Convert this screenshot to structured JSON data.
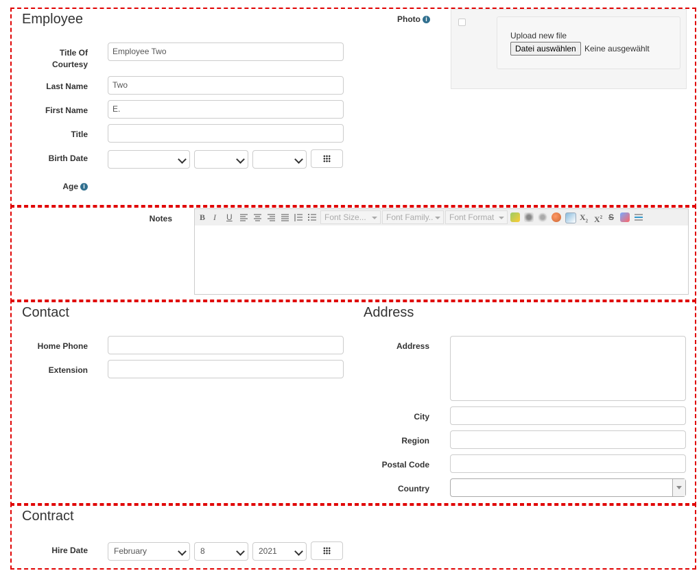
{
  "employee": {
    "heading": "Employee",
    "title_of_courtesy_label": "Title Of Courtesy",
    "title_of_courtesy_value": "Employee Two",
    "last_name_label": "Last Name",
    "last_name_value": "Two",
    "first_name_label": "First Name",
    "first_name_value": "E.",
    "title_label": "Title",
    "title_value": "",
    "birth_date_label": "Birth Date",
    "birth_month": "",
    "birth_day": "",
    "birth_year": "",
    "age_label": "Age",
    "photo_label": "Photo",
    "upload_label": "Upload new file",
    "file_button": "Datei auswählen",
    "file_status": "Keine ausgewählt"
  },
  "notes": {
    "label": "Notes",
    "toolbar": {
      "bold": "B",
      "italic": "I",
      "underline": "U",
      "font_size": "Font Size...",
      "font_family": "Font Family..",
      "font_format": "Font Format",
      "subscript": "X",
      "superscript": "X",
      "strike": "S"
    }
  },
  "contact": {
    "heading": "Contact",
    "home_phone_label": "Home Phone",
    "home_phone_value": "",
    "extension_label": "Extension",
    "extension_value": ""
  },
  "address": {
    "heading": "Address",
    "address_label": "Address",
    "city_label": "City",
    "region_label": "Region",
    "postal_code_label": "Postal Code",
    "country_label": "Country",
    "country_value": ""
  },
  "contract": {
    "heading": "Contract",
    "hire_date_label": "Hire Date",
    "hire_month": "February",
    "hire_day": "8",
    "hire_year": "2021"
  }
}
